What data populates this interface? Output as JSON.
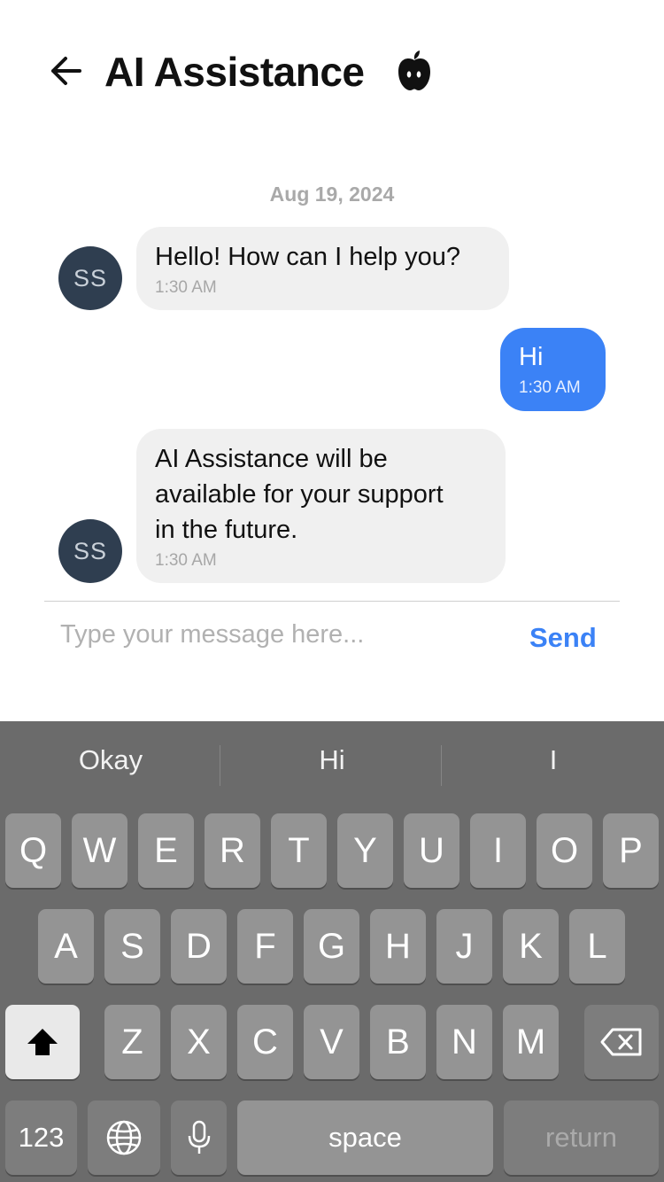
{
  "header": {
    "title": "AI Assistance",
    "back_icon": "arrow-left-icon",
    "brand_icon": "apple-icon"
  },
  "chat": {
    "date": "Aug 19, 2024",
    "messages": [
      {
        "sender": "assistant",
        "avatar": "SS",
        "text": "Hello! How can I help you?",
        "time": "1:30 AM"
      },
      {
        "sender": "user",
        "text": "Hi",
        "time": "1:30 AM"
      },
      {
        "sender": "assistant",
        "avatar": "SS",
        "lines": [
          "AI Assistance will be",
          "available for your support",
          "in the future."
        ],
        "time": "1:30 AM"
      }
    ]
  },
  "composer": {
    "placeholder": "Type your message here...",
    "value": "",
    "send_label": "Send"
  },
  "keyboard": {
    "suggestions": [
      "Okay",
      "Hi",
      "I"
    ],
    "row1": [
      "Q",
      "W",
      "E",
      "R",
      "T",
      "Y",
      "U",
      "I",
      "O",
      "P"
    ],
    "row2": [
      "A",
      "S",
      "D",
      "F",
      "G",
      "H",
      "J",
      "K",
      "L"
    ],
    "row3": [
      "Z",
      "X",
      "C",
      "V",
      "B",
      "N",
      "M"
    ],
    "numbers_label": "123",
    "space_label": "space",
    "return_label": "return",
    "shift_icon": "shift-icon",
    "delete_icon": "delete-icon",
    "globe_icon": "globe-icon",
    "mic_icon": "microphone-icon"
  },
  "colors": {
    "accent": "#3b82f6",
    "avatar_bg": "#2f3e50",
    "incoming_bubble": "#f0f0f0",
    "keyboard_bg": "#6b6b6b"
  }
}
